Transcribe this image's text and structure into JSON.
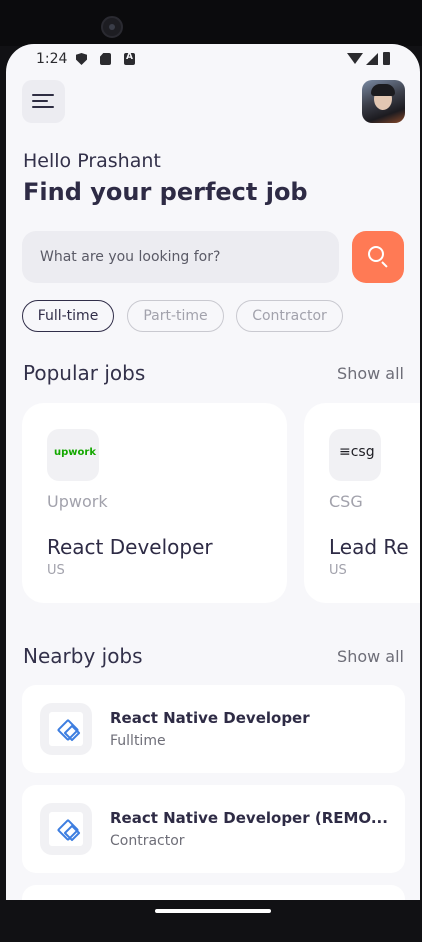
{
  "status_bar": {
    "time": "1:24",
    "icons": [
      "shield-icon",
      "sim-card-icon",
      "a-badge-icon",
      "wifi-icon",
      "cell-signal-icon",
      "battery-icon"
    ]
  },
  "header": {
    "menu_icon": "hamburger-menu-icon",
    "avatar": "user-avatar"
  },
  "greeting": "Hello Prashant",
  "headline": "Find your perfect job",
  "search": {
    "placeholder": "What are you looking for?",
    "button_icon": "search-icon",
    "button_color": "#ff7a55"
  },
  "filters": [
    {
      "label": "Full-time",
      "active": true
    },
    {
      "label": "Part-time",
      "active": false
    },
    {
      "label": "Contractor",
      "active": false
    }
  ],
  "popular": {
    "title": "Popular jobs",
    "show_all": "Show all",
    "jobs": [
      {
        "logo_text": "upwork",
        "company": "Upwork",
        "role": "React Developer",
        "location": "US"
      },
      {
        "logo_text": "≡csg",
        "company": "CSG",
        "role": "Lead Re",
        "location": "US"
      }
    ]
  },
  "nearby": {
    "title": "Nearby jobs",
    "show_all": "Show all",
    "jobs": [
      {
        "title": "React Native Developer",
        "type": "Fulltime",
        "logo_icon": "company-logo-icon"
      },
      {
        "title": "React Native Developer (REMO...",
        "type": "Contractor",
        "logo_icon": "company-logo-icon"
      }
    ]
  },
  "colors": {
    "accent": "#ff7a55",
    "text_dark": "#2e2b45",
    "muted": "#a2a2ac",
    "background": "#f7f7fa"
  }
}
